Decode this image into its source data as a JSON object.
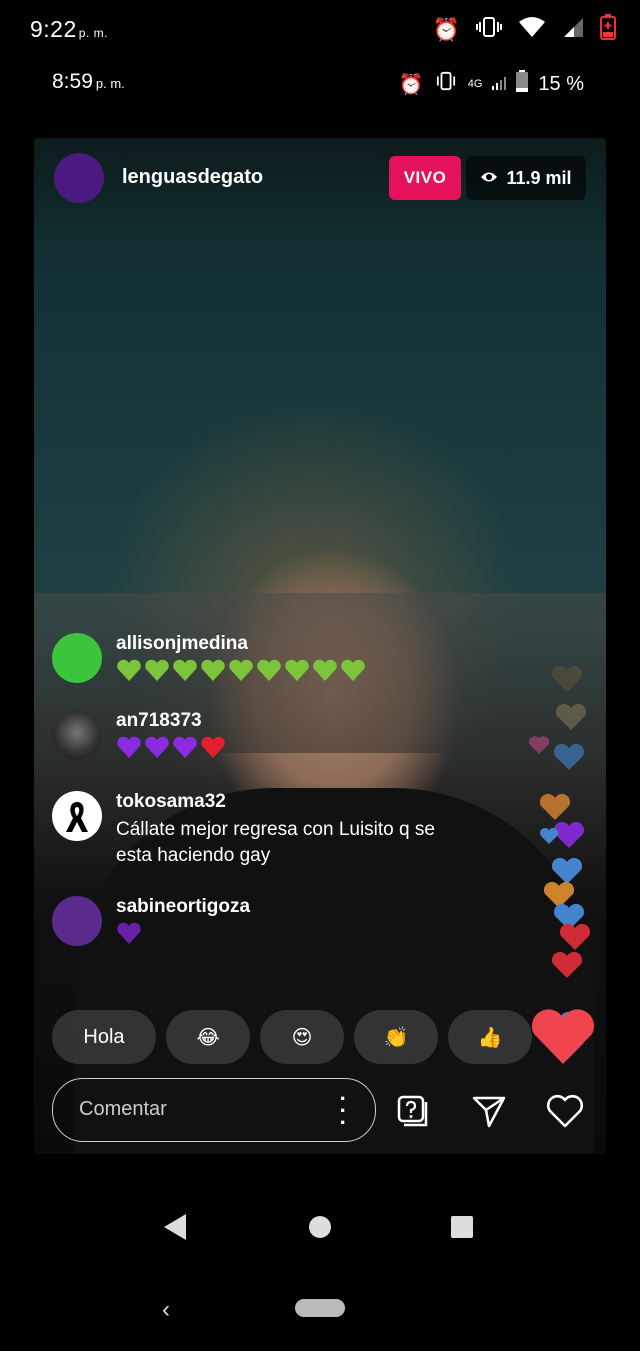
{
  "outer_status": {
    "time": "9:22",
    "ampm": "p. m.",
    "icons": [
      "alarm-icon",
      "vibrate-icon",
      "wifi-icon",
      "signal-icon",
      "battery-low-icon"
    ]
  },
  "inner_status": {
    "time": "8:59",
    "ampm": "p. m.",
    "network": "4G",
    "battery": "15 %",
    "icons": [
      "alarm-icon",
      "vibrate-icon",
      "signal-icon",
      "battery-icon"
    ]
  },
  "live": {
    "host": "lenguasdegato",
    "badge": "VIVO",
    "viewers": "11.9 mil",
    "colors": {
      "badge": "#e3125b",
      "host_avatar": "#4b1a80"
    }
  },
  "comments": [
    {
      "user": "allisonjmedina",
      "text": "",
      "emoji": "green-heart x9",
      "avatar_color": "#3cc43c"
    },
    {
      "user": "an718373",
      "text": "",
      "emoji": "purple-heart x3, red-heart x1",
      "avatar_color": "#333333"
    },
    {
      "user": "tokosama32",
      "text": "Cállate mejor regresa con Luisito q se\nesta haciendo gay",
      "emoji": "",
      "avatar_color": "#ffffff"
    },
    {
      "user": "sabineortigoza",
      "text": "",
      "emoji": "purple-heart x1",
      "avatar_color": "#5a2a8c"
    }
  ],
  "quick_replies": [
    {
      "label": "Hola"
    },
    {
      "label": "😂"
    },
    {
      "label": "😍"
    },
    {
      "label": "👏"
    },
    {
      "label": "👍"
    }
  ],
  "composer": {
    "placeholder": "Comentar",
    "icons": [
      "more-vertical-icon",
      "question-box-icon",
      "send-icon",
      "heart-icon"
    ]
  },
  "navigation": {
    "icons": [
      "back-icon",
      "home-icon",
      "recents-icon",
      "chevron-back-icon",
      "gesture-pill"
    ]
  }
}
